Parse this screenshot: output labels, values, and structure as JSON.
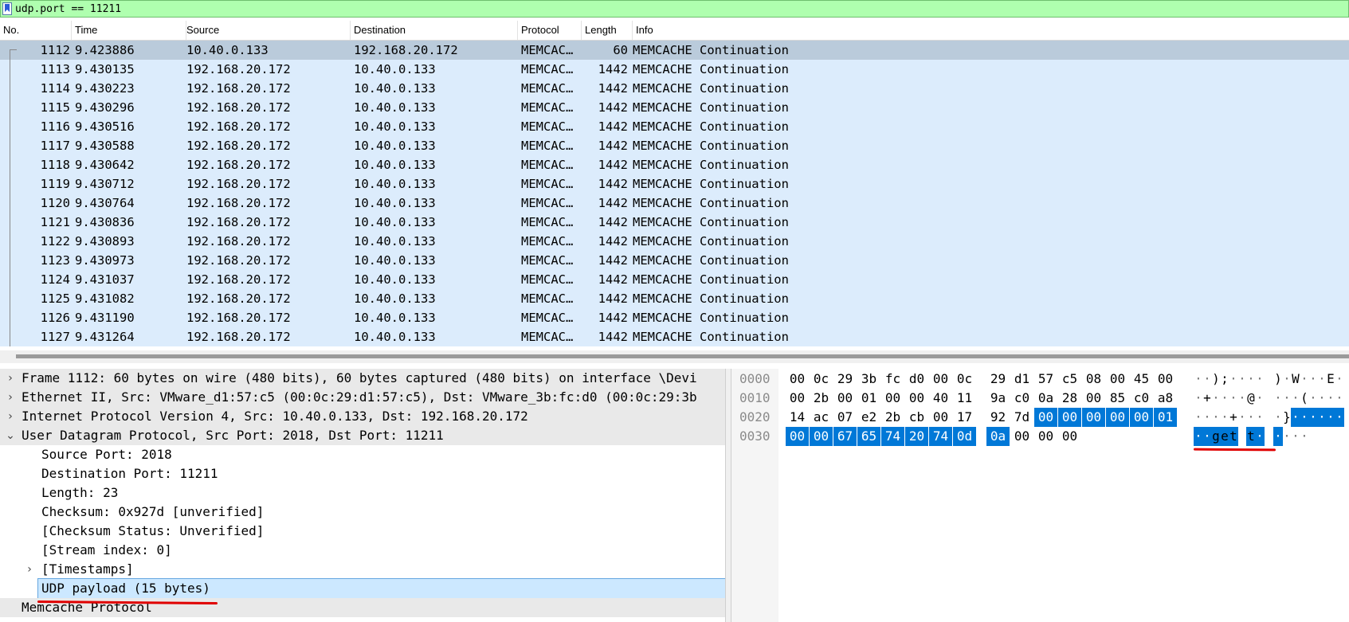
{
  "filter": {
    "value": "udp.port == 11211"
  },
  "columns": [
    "No.",
    "Time",
    "Source",
    "Destination",
    "Protocol",
    "Length",
    "Info"
  ],
  "packets": [
    {
      "no": "1112",
      "time": "9.423886",
      "src": "10.40.0.133",
      "dst": "192.168.20.172",
      "proto": "MEMCAC…",
      "len": "60",
      "info": "MEMCACHE Continuation"
    },
    {
      "no": "1113",
      "time": "9.430135",
      "src": "192.168.20.172",
      "dst": "10.40.0.133",
      "proto": "MEMCAC…",
      "len": "1442",
      "info": "MEMCACHE Continuation"
    },
    {
      "no": "1114",
      "time": "9.430223",
      "src": "192.168.20.172",
      "dst": "10.40.0.133",
      "proto": "MEMCAC…",
      "len": "1442",
      "info": "MEMCACHE Continuation"
    },
    {
      "no": "1115",
      "time": "9.430296",
      "src": "192.168.20.172",
      "dst": "10.40.0.133",
      "proto": "MEMCAC…",
      "len": "1442",
      "info": "MEMCACHE Continuation"
    },
    {
      "no": "1116",
      "time": "9.430516",
      "src": "192.168.20.172",
      "dst": "10.40.0.133",
      "proto": "MEMCAC…",
      "len": "1442",
      "info": "MEMCACHE Continuation"
    },
    {
      "no": "1117",
      "time": "9.430588",
      "src": "192.168.20.172",
      "dst": "10.40.0.133",
      "proto": "MEMCAC…",
      "len": "1442",
      "info": "MEMCACHE Continuation"
    },
    {
      "no": "1118",
      "time": "9.430642",
      "src": "192.168.20.172",
      "dst": "10.40.0.133",
      "proto": "MEMCAC…",
      "len": "1442",
      "info": "MEMCACHE Continuation"
    },
    {
      "no": "1119",
      "time": "9.430712",
      "src": "192.168.20.172",
      "dst": "10.40.0.133",
      "proto": "MEMCAC…",
      "len": "1442",
      "info": "MEMCACHE Continuation"
    },
    {
      "no": "1120",
      "time": "9.430764",
      "src": "192.168.20.172",
      "dst": "10.40.0.133",
      "proto": "MEMCAC…",
      "len": "1442",
      "info": "MEMCACHE Continuation"
    },
    {
      "no": "1121",
      "time": "9.430836",
      "src": "192.168.20.172",
      "dst": "10.40.0.133",
      "proto": "MEMCAC…",
      "len": "1442",
      "info": "MEMCACHE Continuation"
    },
    {
      "no": "1122",
      "time": "9.430893",
      "src": "192.168.20.172",
      "dst": "10.40.0.133",
      "proto": "MEMCAC…",
      "len": "1442",
      "info": "MEMCACHE Continuation"
    },
    {
      "no": "1123",
      "time": "9.430973",
      "src": "192.168.20.172",
      "dst": "10.40.0.133",
      "proto": "MEMCAC…",
      "len": "1442",
      "info": "MEMCACHE Continuation"
    },
    {
      "no": "1124",
      "time": "9.431037",
      "src": "192.168.20.172",
      "dst": "10.40.0.133",
      "proto": "MEMCAC…",
      "len": "1442",
      "info": "MEMCACHE Continuation"
    },
    {
      "no": "1125",
      "time": "9.431082",
      "src": "192.168.20.172",
      "dst": "10.40.0.133",
      "proto": "MEMCAC…",
      "len": "1442",
      "info": "MEMCACHE Continuation"
    },
    {
      "no": "1126",
      "time": "9.431190",
      "src": "192.168.20.172",
      "dst": "10.40.0.133",
      "proto": "MEMCAC…",
      "len": "1442",
      "info": "MEMCACHE Continuation"
    },
    {
      "no": "1127",
      "time": "9.431264",
      "src": "192.168.20.172",
      "dst": "10.40.0.133",
      "proto": "MEMCAC…",
      "len": "1442",
      "info": "MEMCACHE Continuation"
    }
  ],
  "details": [
    {
      "text": "Frame 1112: 60 bytes on wire (480 bits), 60 bytes captured (480 bits) on interface \\Devi",
      "expander": "collapsed",
      "level": 0,
      "state": "hl"
    },
    {
      "text": "Ethernet II, Src: VMware_d1:57:c5 (00:0c:29:d1:57:c5), Dst: VMware_3b:fc:d0 (00:0c:29:3b",
      "expander": "collapsed",
      "level": 0,
      "state": "hl"
    },
    {
      "text": "Internet Protocol Version 4, Src: 10.40.0.133, Dst: 192.168.20.172",
      "expander": "collapsed",
      "level": 0,
      "state": "hl"
    },
    {
      "text": "User Datagram Protocol, Src Port: 2018, Dst Port: 11211",
      "expander": "expanded",
      "level": 0,
      "state": "hl"
    },
    {
      "text": "Source Port: 2018",
      "expander": "none",
      "level": 1,
      "state": ""
    },
    {
      "text": "Destination Port: 11211",
      "expander": "none",
      "level": 1,
      "state": ""
    },
    {
      "text": "Length: 23",
      "expander": "none",
      "level": 1,
      "state": ""
    },
    {
      "text": "Checksum: 0x927d [unverified]",
      "expander": "none",
      "level": 1,
      "state": ""
    },
    {
      "text": "[Checksum Status: Unverified]",
      "expander": "none",
      "level": 1,
      "state": ""
    },
    {
      "text": "[Stream index: 0]",
      "expander": "none",
      "level": 1,
      "state": ""
    },
    {
      "text": "[Timestamps]",
      "expander": "collapsed",
      "level": 1,
      "state": ""
    },
    {
      "text": "UDP payload (15 bytes)",
      "expander": "none",
      "level": 1,
      "state": "sel"
    },
    {
      "text": "Memcache Protocol",
      "expander": "none",
      "level": 0,
      "state": "hl"
    }
  ],
  "hex": [
    {
      "offset": "0000",
      "bytes": [
        "00",
        "0c",
        "29",
        "3b",
        "fc",
        "d0",
        "00",
        "0c",
        "29",
        "d1",
        "57",
        "c5",
        "08",
        "00",
        "45",
        "00"
      ],
      "ascii": [
        "·",
        "·",
        ")",
        ";",
        "·",
        "·",
        "·",
        "·",
        ")",
        "·",
        "W",
        "·",
        "·",
        "·",
        "E",
        "·"
      ],
      "hl_from": -1
    },
    {
      "offset": "0010",
      "bytes": [
        "00",
        "2b",
        "00",
        "01",
        "00",
        "00",
        "40",
        "11",
        "9a",
        "c0",
        "0a",
        "28",
        "00",
        "85",
        "c0",
        "a8"
      ],
      "ascii": [
        "·",
        "+",
        "·",
        "·",
        "·",
        "·",
        "@",
        "·",
        "·",
        "·",
        "·",
        "(",
        "·",
        "·",
        "·",
        "·"
      ],
      "hl_from": -1
    },
    {
      "offset": "0020",
      "bytes": [
        "14",
        "ac",
        "07",
        "e2",
        "2b",
        "cb",
        "00",
        "17",
        "92",
        "7d",
        "00",
        "00",
        "00",
        "00",
        "00",
        "01"
      ],
      "ascii": [
        "·",
        "·",
        "·",
        "·",
        "+",
        "·",
        "·",
        "·",
        "·",
        "}",
        "·",
        "·",
        "·",
        "·",
        "·",
        "·"
      ],
      "hl_from": 10,
      "hl_to": 16
    },
    {
      "offset": "0030",
      "bytes": [
        "00",
        "00",
        "67",
        "65",
        "74",
        "20",
        "74",
        "0d",
        "0a",
        "00",
        "00",
        "00"
      ],
      "ascii": [
        "·",
        "·",
        "g",
        "e",
        "t",
        " ",
        "t",
        "·",
        "·",
        "·",
        "·",
        "·"
      ],
      "hl_from": 0,
      "hl_to": 9
    }
  ],
  "colors": {
    "filter_bg": "#afffaf",
    "packet_row": "#dcecfc",
    "packet_selected": "#bacbdb",
    "hex_highlight": "#0078d7",
    "annotation": "#e00000"
  }
}
